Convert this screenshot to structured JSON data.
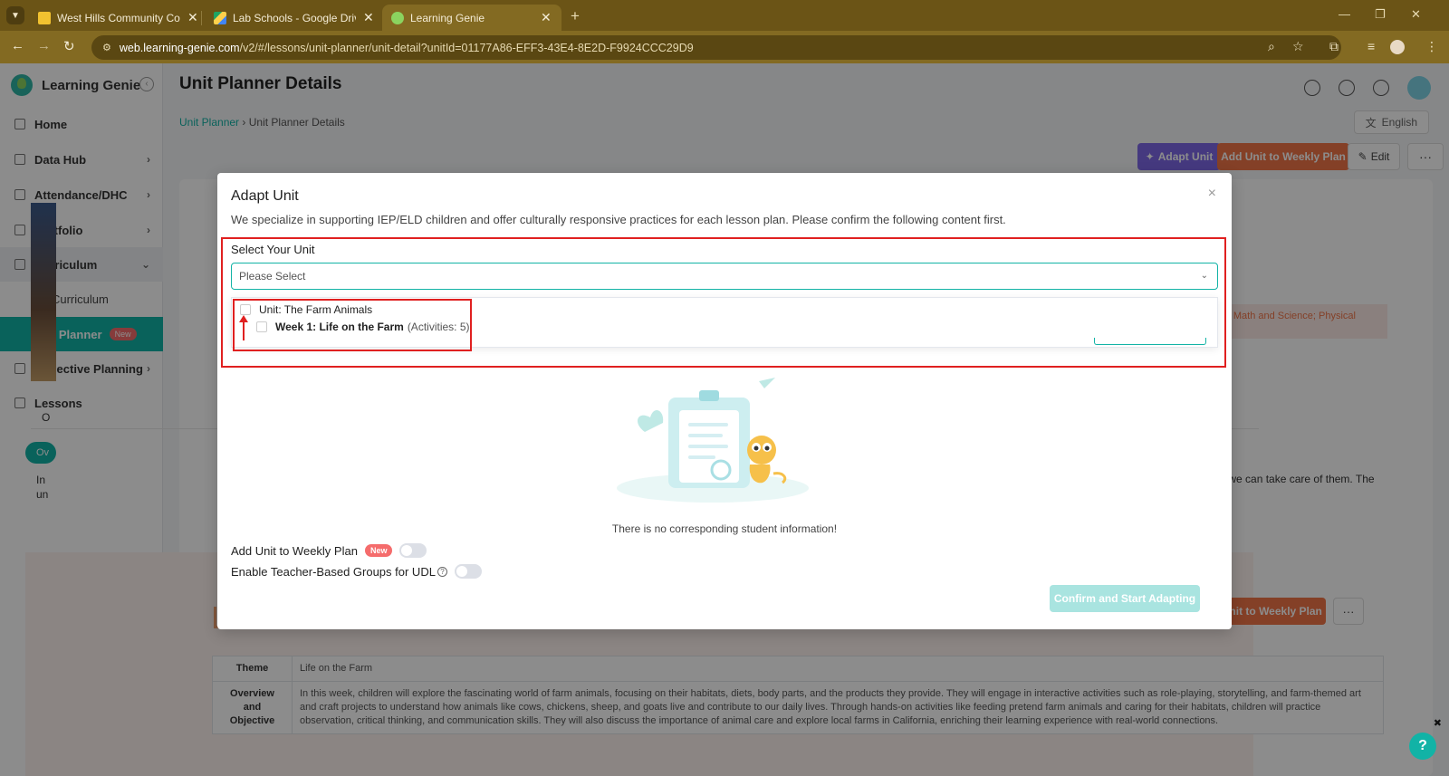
{
  "browser": {
    "tabs": [
      {
        "title": "West Hills Community College"
      },
      {
        "title": "Lab Schools - Google Drive"
      },
      {
        "title": "Learning Genie"
      }
    ],
    "url_host": "web.learning-genie.com",
    "url_path": "/v2/#/lessons/unit-planner/unit-detail?unitId=01177A86-EFF3-43E4-8E2D-F9924CCC29D9"
  },
  "sidebar": {
    "brand": "Learning Genie",
    "items": [
      {
        "label": "Home"
      },
      {
        "label": "Data Hub"
      },
      {
        "label": "Attendance/DHC"
      },
      {
        "label": "Portfolio"
      },
      {
        "label": "Curriculum"
      },
      {
        "label": "LG Curriculum"
      },
      {
        "label": "Unit Planner",
        "badge": "New"
      },
      {
        "label": "Reflective Planning"
      },
      {
        "label": "Lessons"
      }
    ]
  },
  "header": {
    "title": "Unit Planner Details",
    "breadcrumb_root": "Unit Planner",
    "breadcrumb_current": "Unit Planner Details",
    "language": "English"
  },
  "actions": {
    "adapt": "Adapt Unit",
    "add_weekly": "Add Unit to Weekly Plan",
    "edit": "Edit",
    "more": "···"
  },
  "background": {
    "tab_o": "O",
    "pill_ov": "Ov",
    "line1_prefix": "In",
    "line2_prefix": "un",
    "right_fragment": "how we can take care of them. The",
    "std_fragment": "ding Math and Science; Physical",
    "week_add": "Add Unit to Weekly Plan",
    "week_more": "···",
    "table": {
      "theme_label": "Theme",
      "theme_value": "Life on the Farm",
      "overview_label": "Overview and Objective",
      "overview_value": "In this week, children will explore the fascinating world of farm animals, focusing on their habitats, diets, body parts, and the products they provide. They will engage in interactive activities such as role-playing, storytelling, and farm-themed art and craft projects to understand how animals like cows, chickens, sheep, and goats live and contribute to our daily lives. Through hands-on activities like feeding pretend farm animals and caring for their habitats, children will practice observation, critical thinking, and communication skills. They will also discuss the importance of animal care and explore local farms in California, enriching their learning experience with real-world connections."
    }
  },
  "modal": {
    "title": "Adapt Unit",
    "description": "We specialize in supporting IEP/ELD children and offer culturally responsive practices for each lesson plan. Please confirm the following content first.",
    "select_label": "Select Your Unit",
    "select_placeholder": "Please Select",
    "unit_option": "Unit: The Farm Animals",
    "week_option": "Week 1: Life on the Farm",
    "week_activities": "(Activities: 5)",
    "no_info": "There is no corresponding student information!",
    "toggle_weekly_label": "Add Unit to Weekly Plan",
    "toggle_weekly_badge": "New",
    "toggle_udl_label": "Enable Teacher-Based Groups for UDL",
    "confirm": "Confirm and Start Adapting"
  },
  "colors": {
    "accent": "#12b3a6",
    "orange": "#f07548",
    "purple": "#7e68e8",
    "highlight": "#e02020"
  }
}
